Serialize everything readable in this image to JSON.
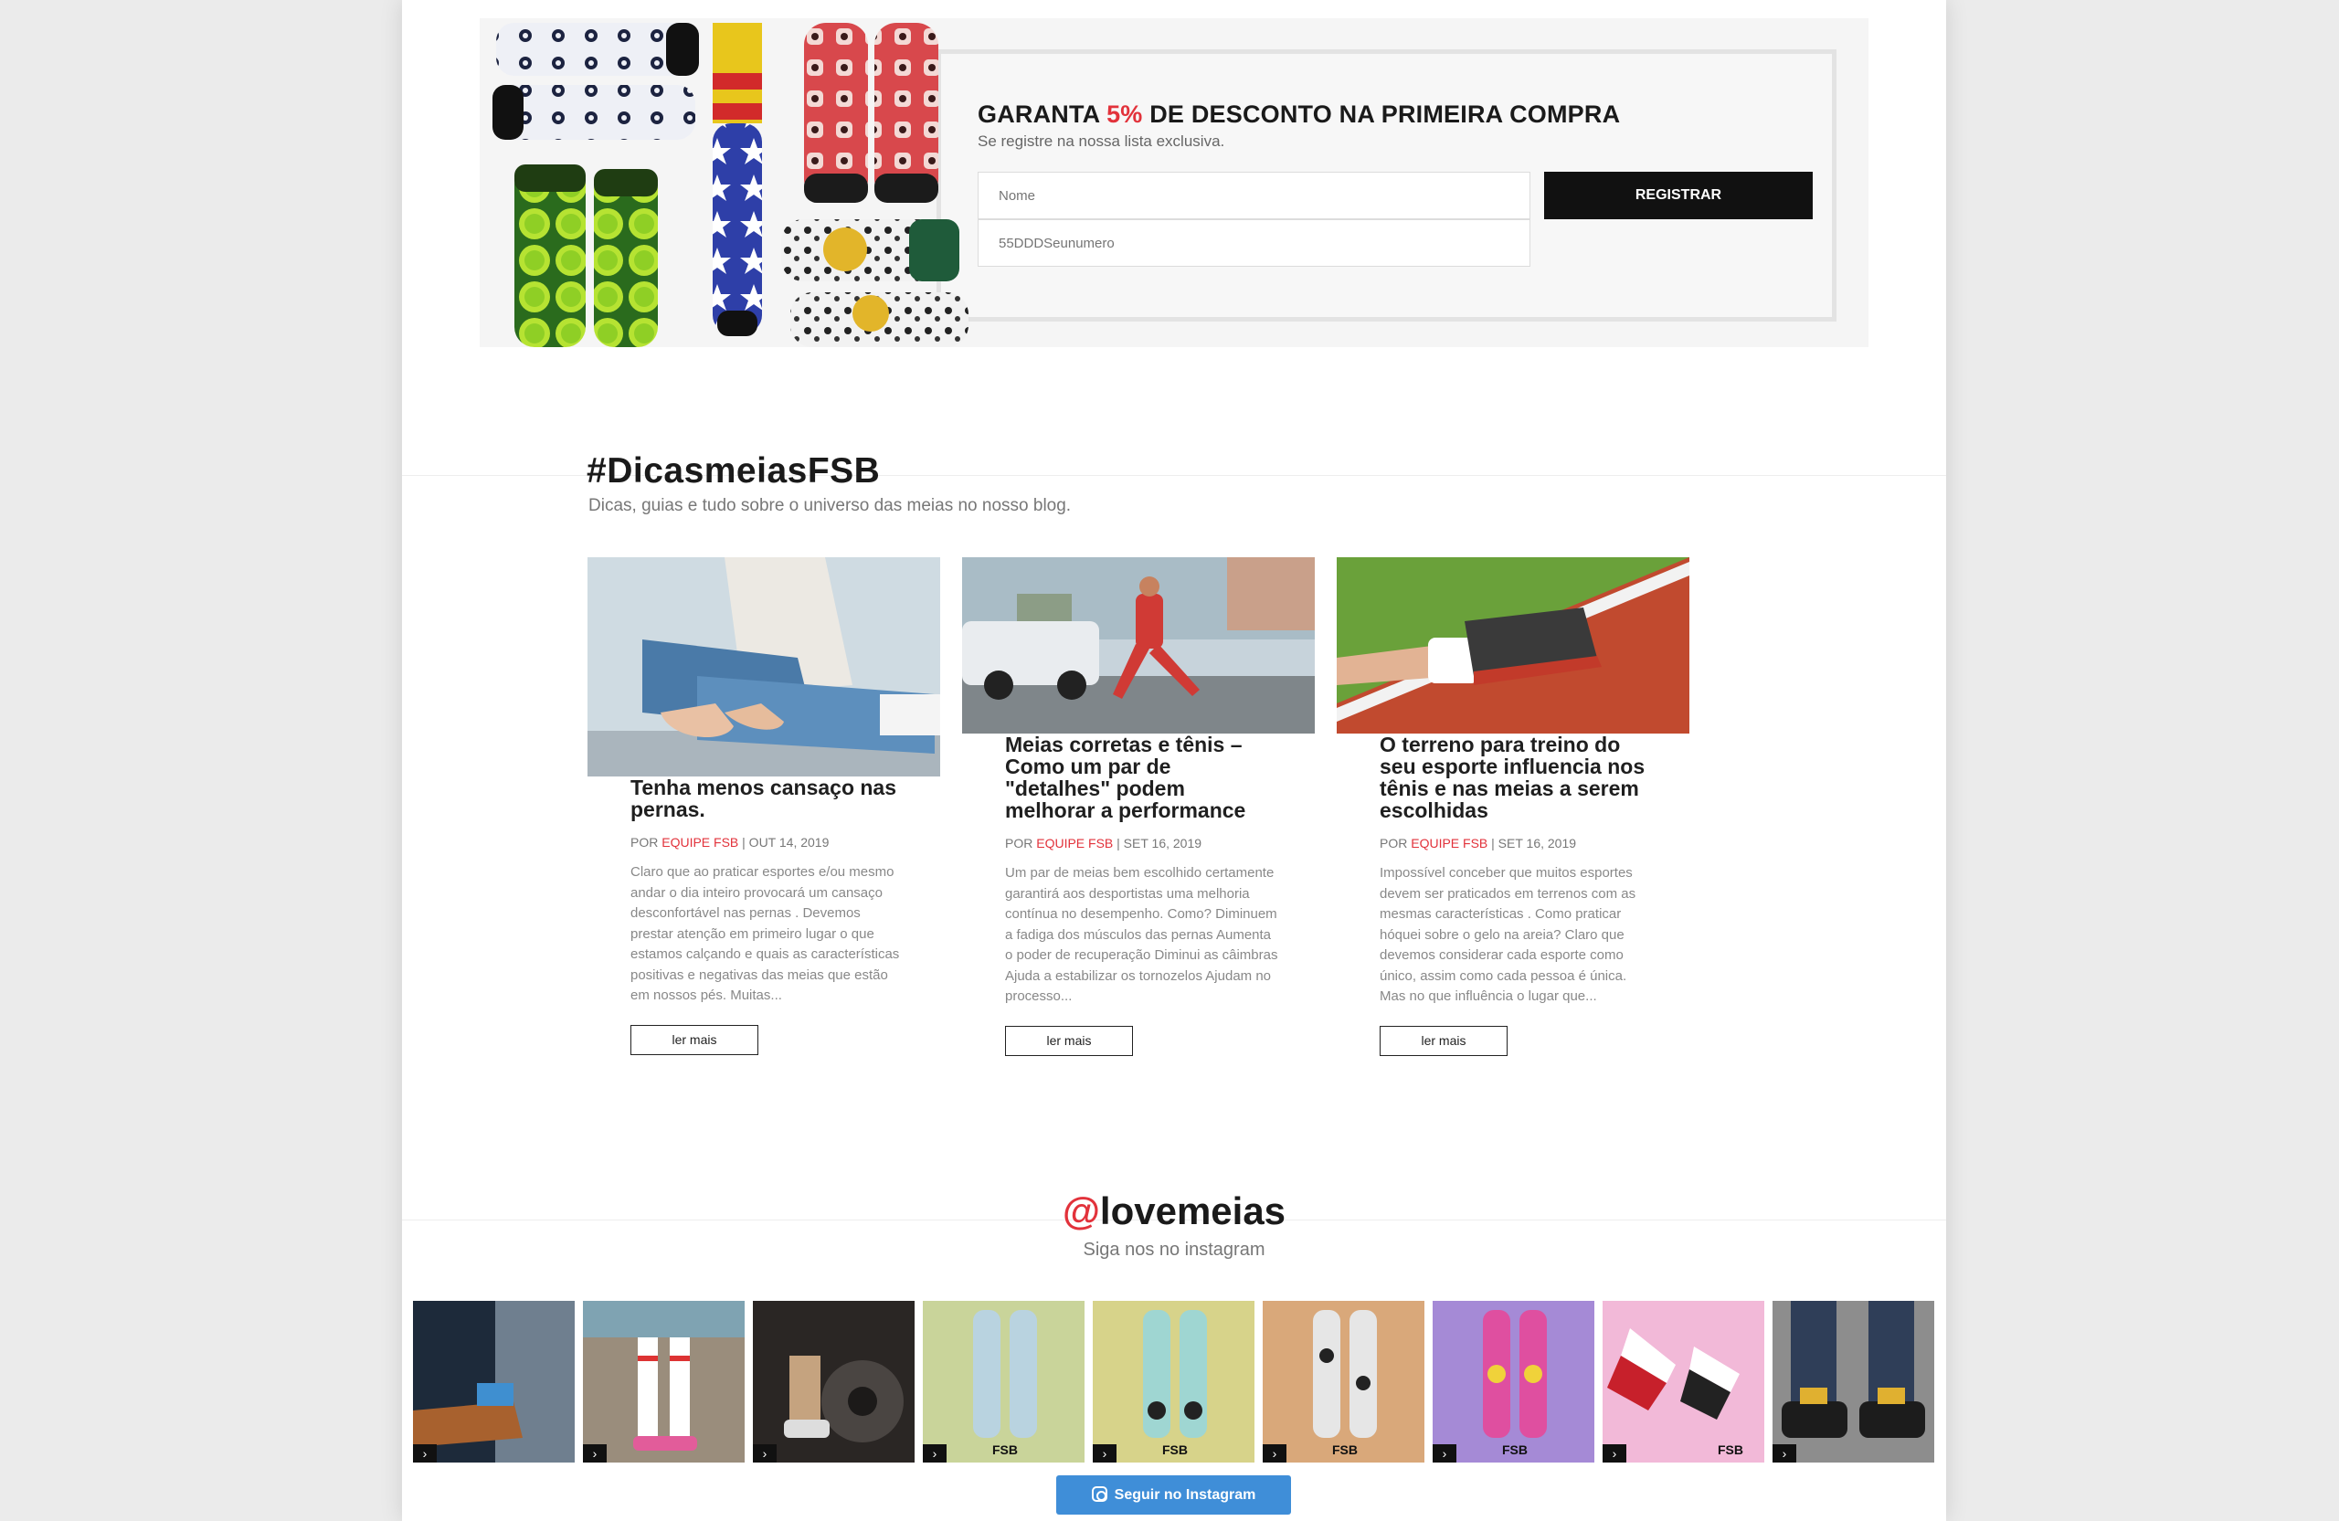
{
  "newsletter": {
    "title_pre": "GARANTA ",
    "title_highlight": "5%",
    "title_post": " DE DESCONTO NA PRIMEIRA COMPRA",
    "subtitle": "Se registre na nossa lista exclusiva.",
    "name_placeholder": "Nome",
    "phone_placeholder": "55DDDSeunumero",
    "submit_label": "REGISTRAR"
  },
  "blog": {
    "title": "#DicasmeiasFSB",
    "subtitle": "Dicas, guias e tudo sobre o universo das meias no nosso blog.",
    "posts": [
      {
        "title": "Tenha menos cansaço nas pernas.",
        "meta_prefix": "POR ",
        "author": "EQUIPE FSB",
        "date": " | OUT 14, 2019",
        "excerpt": "Claro que ao praticar esportes e/ou mesmo andar o dia inteiro provocará um cansaço desconfortável nas pernas . Devemos prestar atenção em primeiro lugar o que estamos calçando e quais as características positivas e negativas das meias que estão em nossos pés. Muitas...",
        "read_more": "ler mais"
      },
      {
        "title": "Meias corretas e tênis – Como um par de \"detalhes\" podem melhorar a performance",
        "meta_prefix": "POR ",
        "author": "EQUIPE FSB",
        "date": " | SET 16, 2019",
        "excerpt": "Um par de meias bem escolhido certamente garantirá aos desportistas uma melhoria contínua no desempenho. Como? Diminuem a fadiga dos músculos das pernas Aumenta o poder de recuperação Diminui as câimbras Ajuda a estabilizar os tornozelos Ajudam no processo...",
        "read_more": "ler mais"
      },
      {
        "title": "O terreno para treino do seu esporte influencia nos tênis e nas meias a serem escolhidas",
        "meta_prefix": "POR ",
        "author": "EQUIPE FSB",
        "date": " | SET 16, 2019",
        "excerpt": "Impossível conceber que muitos esportes devem ser praticados em terrenos com as mesmas características . Como praticar hóquei sobre o gelo na areia? Claro que devemos considerar cada esporte como único, assim como cada pessoa é única. Mas no que influência o lugar que...",
        "read_more": "ler mais"
      }
    ]
  },
  "instagram": {
    "at": "@",
    "handle": "lovemeias",
    "subtitle": "Siga nos no instagram",
    "follow_label": "Seguir no Instagram",
    "item_arrow": "›",
    "brand_mark": "FSB"
  },
  "colors": {
    "accent": "#e2323b",
    "button_dark": "#111111",
    "instagram_blue": "#3f8ed8"
  }
}
